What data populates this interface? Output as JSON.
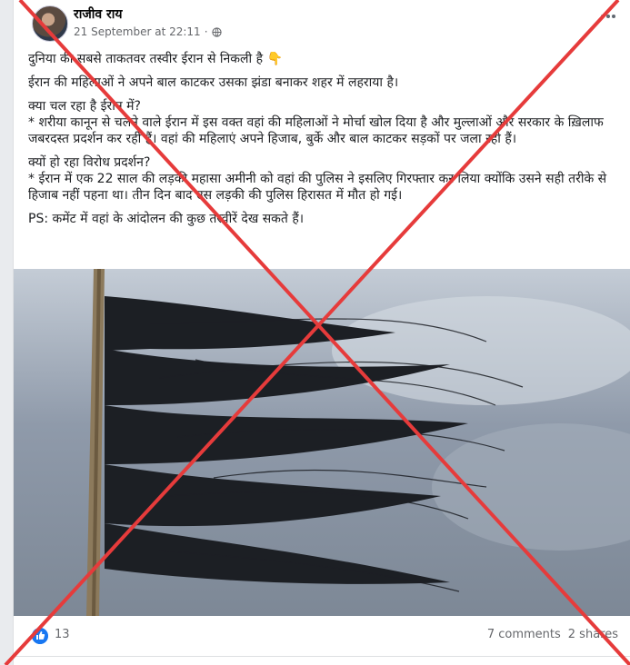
{
  "post": {
    "author": "राजीव राय",
    "timestamp": "21 September at 22:11",
    "privacy_icon": "globe-icon",
    "menu_icon": "more-options-icon",
    "text": {
      "headline": "दुनिया की सबसे ताकतवर तस्वीर ईरान से निकली है 👇",
      "line2": "ईरान की महिलाओं ने अपने बाल काटकर उसका झंडा बनाकर शहर में लहराया है।",
      "para3": "क्या चल रहा है ईरान में?\n* शरीया कानून से चलने वाले ईरान में इस वक्त वहां की महिलाओं ने मोर्चा खोल दिया है और मुल्लाओं और सरकार के ख़िलाफ जबरदस्त प्रदर्शन कर रही हैं। वहां की महिलाएं अपने हिजाब, बुर्के और बाल काटकर सड़कों पर जला रही हैं।",
      "para4": "क्यों हो रहा विरोध प्रदर्शन?\n* ईरान में एक 22 साल की लड़की महासा अमीनी को वहां की पुलिस ने इसलिए गिरफ्तार कर लिया क्योंकि उसने सही तरीके से हिजाब नहीं पहना था। तीन दिन बाद उस लड़की की पुलिस हिरासत में मौत हो गई।",
      "ps": "PS: कमेंट में वहां के आंदोलन की कुछ तस्वीरें देख सकते हैं।"
    }
  },
  "footer": {
    "reaction_icon": "like-reaction-icon",
    "reaction_count": "13",
    "comments": "7 comments",
    "shares": "2 shares"
  },
  "overlay": {
    "cross_color": "#e63b3b"
  }
}
